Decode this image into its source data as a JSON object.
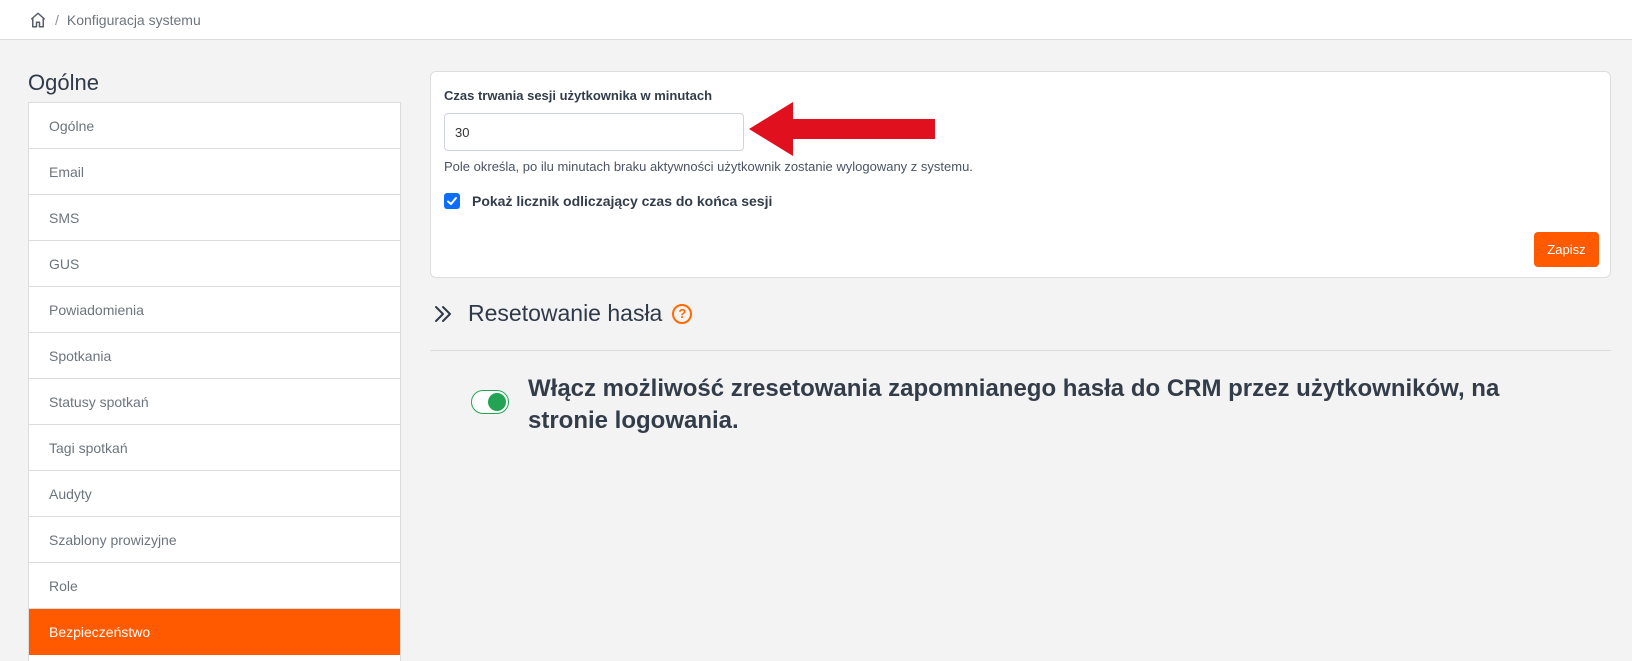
{
  "breadcrumb": {
    "home_icon": "home-icon",
    "separator": "/",
    "current": "Konfiguracja systemu"
  },
  "sidebar": {
    "title": "Ogólne",
    "items": [
      {
        "label": "Ogólne"
      },
      {
        "label": "Email"
      },
      {
        "label": "SMS"
      },
      {
        "label": "GUS"
      },
      {
        "label": "Powiadomienia"
      },
      {
        "label": "Spotkania"
      },
      {
        "label": "Statusy spotkań"
      },
      {
        "label": "Tagi spotkań"
      },
      {
        "label": "Audyty"
      },
      {
        "label": "Szablony prowizyjne"
      },
      {
        "label": "Role"
      },
      {
        "label": "Bezpieczeństwo",
        "active": true
      }
    ]
  },
  "session_card": {
    "label": "Czas trwania sesji użytkownika w minutach",
    "value": "30",
    "help": "Pole określa, po ilu minutach braku aktywności użytkownik zostanie wylogowany z systemu.",
    "countdown_checkbox": {
      "label": "Pokaż licznik odliczający czas do końca sesji",
      "checked": true
    },
    "save_label": "Zapisz"
  },
  "password_reset": {
    "title": "Resetowanie hasła",
    "help_icon": "?",
    "toggle_on": true,
    "toggle_label": "Włącz możliwość zresetowania zapomnianego hasła do CRM przez użytkowników, na stronie logowania."
  },
  "colors": {
    "accent": "#ff5a00",
    "toggle_on": "#23a455",
    "checkbox": "#0d6efd",
    "arrow": "#e0101e"
  }
}
